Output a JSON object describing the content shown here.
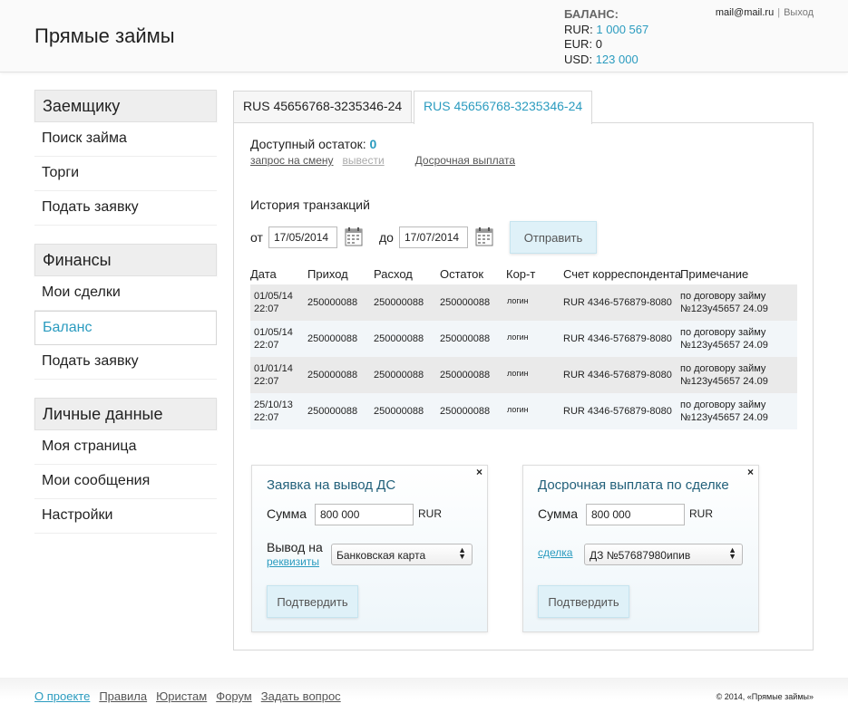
{
  "header": {
    "logo": "Прямые займы",
    "balance_title": "БАЛАНС:",
    "balances": [
      {
        "cur": "RUR:",
        "val": "1 000 567"
      },
      {
        "cur": "EUR:",
        "val": "0"
      },
      {
        "cur": "USD:",
        "val": "123 000"
      }
    ],
    "email": "mail@mail.ru",
    "separator": "|",
    "logout": "Выход"
  },
  "sidebar": {
    "groups": [
      {
        "title": "Заемщику",
        "items": [
          "Поиск займа",
          "Торги",
          "Подать заявку"
        ]
      },
      {
        "title": "Финансы",
        "items": [
          "Мои сделки",
          "Баланс",
          "Подать заявку"
        ]
      },
      {
        "title": "Личные данные",
        "items": [
          "Моя страница",
          "Мои сообщения",
          "Настройки"
        ]
      }
    ],
    "active_item": "Баланс"
  },
  "tabs": [
    "RUS 45656768-3235346-24",
    "RUS 45656768-3235346-24"
  ],
  "account": {
    "available_label": "Доступный остаток:",
    "available_value": "0",
    "link_change": "запрос на смену",
    "link_withdraw": "вывести",
    "link_early": "Досрочная выплата"
  },
  "history": {
    "title": "История транзакций",
    "from_label": "от",
    "from_value": "17/05/2014",
    "to_label": "до",
    "to_value": "17/07/2014",
    "submit": "Отправить"
  },
  "table": {
    "headers": [
      "Дата",
      "Приход",
      "Расход",
      "Остаток",
      "Кор-т",
      "Счет корреспондента",
      "Примечание"
    ],
    "rows": [
      {
        "date1": "01/05/14",
        "date2": "22:07",
        "income": "250000088",
        "expense": "250000088",
        "rest": "250000088",
        "corr": "логин",
        "account": "RUR 4346-576879-8080",
        "note1": "по договору займу",
        "note2": "№123у45657 24.09"
      },
      {
        "date1": "01/05/14",
        "date2": "22:07",
        "income": "250000088",
        "expense": "250000088",
        "rest": "250000088",
        "corr": "логин",
        "account": "RUR 4346-576879-8080",
        "note1": "по договору займу",
        "note2": "№123у45657 24.09"
      },
      {
        "date1": "01/01/14",
        "date2": "22:07",
        "income": "250000088",
        "expense": "250000088",
        "rest": "250000088",
        "corr": "логин",
        "account": "RUR 4346-576879-8080",
        "note1": "по договору займу",
        "note2": "№123у45657 24.09"
      },
      {
        "date1": "25/10/13",
        "date2": "22:07",
        "income": "250000088",
        "expense": "250000088",
        "rest": "250000088",
        "corr": "логин",
        "account": "RUR 4346-576879-8080",
        "note1": "по договору займу",
        "note2": "№123у45657 24.09"
      }
    ]
  },
  "withdraw_modal": {
    "close": "×",
    "title": "Заявка на вывод ДС",
    "sum_label": "Сумма",
    "sum_value": "800 000",
    "currency": "RUR",
    "method_label": "Вывод на",
    "requisites_link": "реквизиты",
    "method_value": "Банковская карта",
    "confirm": "Подтвердить"
  },
  "early_modal": {
    "close": "×",
    "title": "Досрочная выплата по сделке",
    "sum_label": "Сумма",
    "sum_value": "800 000",
    "currency": "RUR",
    "deal_link": "сделка",
    "deal_value": "ДЗ №57687980ипив",
    "confirm": "Подтвердить"
  },
  "footer": {
    "links": [
      "О проекте",
      "Правила",
      "Юристам",
      "Форум",
      "Задать вопрос"
    ],
    "copyright": "© 2014, «Прямые займы»"
  },
  "colors": {
    "accent": "#2a9bbf",
    "button_bg": "#dff1f8",
    "modal_title": "#22607a"
  }
}
